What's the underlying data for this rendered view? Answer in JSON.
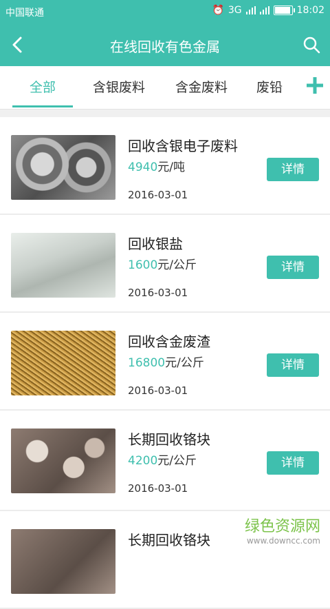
{
  "status": {
    "carrier": "中国联通",
    "network": "3G",
    "time": "18:02",
    "battery_level": 0.85
  },
  "appbar": {
    "title": "在线回收有色金属"
  },
  "tabs": [
    {
      "label": "全部",
      "active": true
    },
    {
      "label": "含银废料",
      "active": false
    },
    {
      "label": "含金废料",
      "active": false
    },
    {
      "label": "废铅",
      "active": false
    }
  ],
  "items": [
    {
      "name": "回收含银电子废料",
      "price": "4940",
      "unit": "元/吨",
      "date": "2016-03-01",
      "button": "详情"
    },
    {
      "name": "回收银盐",
      "price": "1600",
      "unit": "元/公斤",
      "date": "2016-03-01",
      "button": "详情"
    },
    {
      "name": "回收含金废渣",
      "price": "16800",
      "unit": "元/公斤",
      "date": "2016-03-01",
      "button": "详情"
    },
    {
      "name": "长期回收铬块",
      "price": "4200",
      "unit": "元/公斤",
      "date": "2016-03-01",
      "button": "详情"
    },
    {
      "name": "长期回收铬块"
    }
  ],
  "watermark": {
    "line1": "绿色资源网",
    "line2": "www.downcc.com"
  },
  "colors": {
    "accent": "#3fbfae"
  }
}
